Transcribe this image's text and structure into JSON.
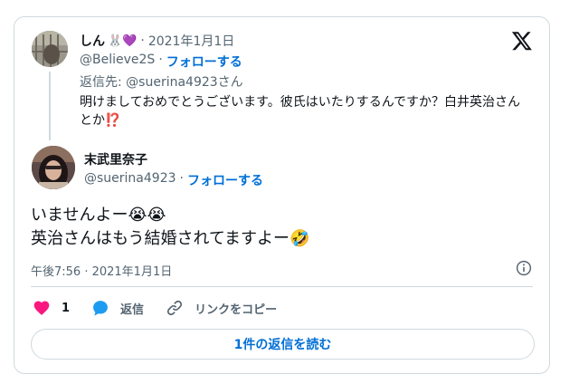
{
  "parent": {
    "name": "しん",
    "name_emojis": "🐰💜",
    "date": "2021年1月1日",
    "handle": "@Believe2S",
    "follow_label": "フォローする",
    "reply_to": "返信先: @suerina4923さん",
    "text": "明けましておめでとうございます。彼氏はいたりするんですか？白井英治さんとか⁉️"
  },
  "child": {
    "name": "末武里奈子",
    "handle": "@suerina4923",
    "follow_label": "フォローする",
    "text_line1": "いませんよー😭😭",
    "text_line2": "英治さんはもう結婚されてますよー🤣",
    "timestamp": "午後7:56 · 2021年1月1日"
  },
  "actions": {
    "like_count": "1",
    "reply_label": "返信",
    "copy_link_label": "リンクをコピー"
  },
  "read_replies_label": "1件の返信を読む",
  "separator": "·",
  "colors": {
    "accent": "#006fd6",
    "like": "#f91880",
    "reply": "#1d9bf0",
    "border": "#cfd9de",
    "muted": "#536471"
  }
}
